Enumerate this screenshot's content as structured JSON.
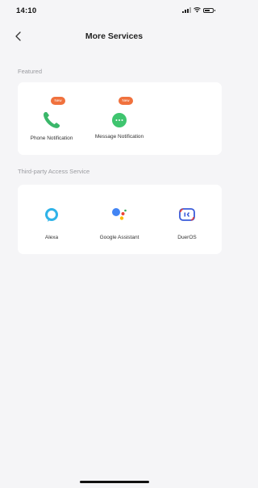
{
  "status_bar": {
    "time": "14:10"
  },
  "nav": {
    "title": "More Services"
  },
  "featured": {
    "section_label": "Featured",
    "items": [
      {
        "label": "Phone Notification",
        "icon": "phone-icon",
        "badge": "New"
      },
      {
        "label": "Message Notification",
        "icon": "message-icon",
        "badge": "New"
      }
    ]
  },
  "third_party": {
    "section_label": "Third-party Access Service",
    "items": [
      {
        "label": "Alexa",
        "icon": "alexa-icon"
      },
      {
        "label": "Google Assistant",
        "icon": "google-assistant-icon"
      },
      {
        "label": "DuerOS",
        "icon": "dueros-icon"
      }
    ]
  },
  "colors": {
    "background": "#f5f5f7",
    "card": "#ffffff",
    "badge": "#f0713d",
    "phone_green": "#3ab76a",
    "message_green": "#3fc56f",
    "alexa_blue": "#2fb3e8"
  }
}
